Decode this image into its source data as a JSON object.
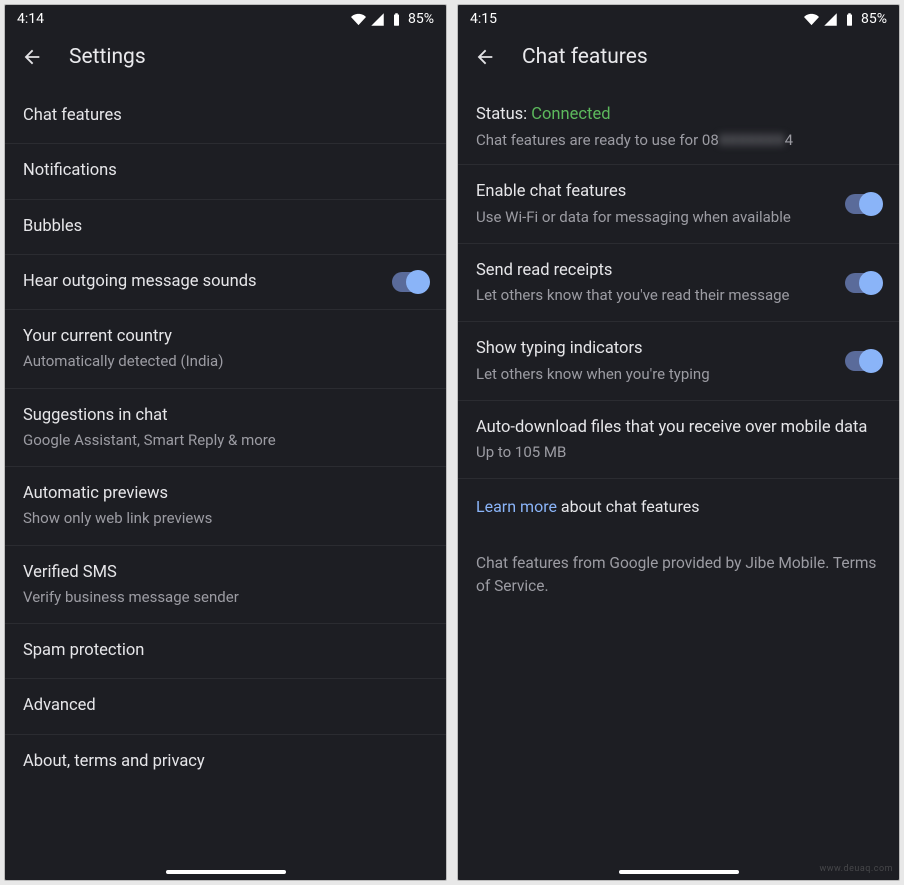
{
  "left": {
    "status": {
      "time": "4:14",
      "battery": "85%"
    },
    "title": "Settings",
    "items": [
      {
        "title": "Chat features"
      },
      {
        "title": "Notifications"
      },
      {
        "title": "Bubbles"
      },
      {
        "title": "Hear outgoing message sounds",
        "toggle": true
      },
      {
        "title": "Your current country",
        "sub": "Automatically detected (India)"
      },
      {
        "title": "Suggestions in chat",
        "sub": "Google Assistant, Smart Reply & more"
      },
      {
        "title": "Automatic previews",
        "sub": "Show only web link previews"
      },
      {
        "title": "Verified SMS",
        "sub": "Verify business message sender"
      },
      {
        "title": "Spam protection"
      },
      {
        "title": "Advanced"
      },
      {
        "title": "About, terms and privacy"
      }
    ]
  },
  "right": {
    "status": {
      "time": "4:15",
      "battery": "85%"
    },
    "title": "Chat features",
    "connection": {
      "label": "Status:",
      "value": "Connected",
      "sub_prefix": "Chat features are ready to use for 08",
      "sub_hidden": "XXXXXXX",
      "sub_suffix": "4"
    },
    "items": [
      {
        "title": "Enable chat features",
        "sub": "Use Wi-Fi or data for messaging when available",
        "toggle": true
      },
      {
        "title": "Send read receipts",
        "sub": "Let others know that you've read their message",
        "toggle": true
      },
      {
        "title": "Show typing indicators",
        "sub": "Let others know when you're typing",
        "toggle": true
      },
      {
        "title": "Auto-download files that you receive over mobile data",
        "sub": "Up to 105 MB"
      }
    ],
    "learn_more": "Learn more",
    "learn_tail": " about chat features",
    "footer": "Chat features from Google provided by Jibe Mobile. Terms of Service."
  },
  "watermark": "www.deuaq.com"
}
